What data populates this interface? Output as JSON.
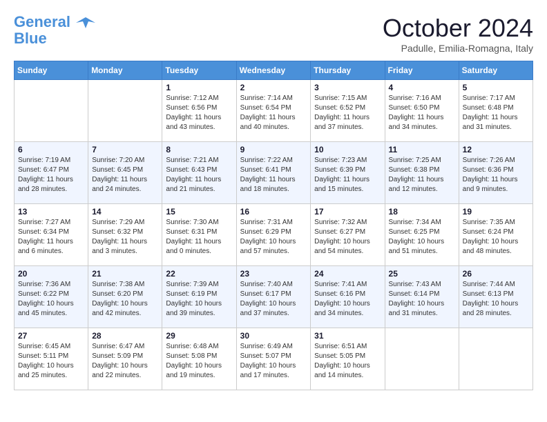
{
  "header": {
    "logo_line1": "General",
    "logo_line2": "Blue",
    "month": "October 2024",
    "location": "Padulle, Emilia-Romagna, Italy"
  },
  "days_of_week": [
    "Sunday",
    "Monday",
    "Tuesday",
    "Wednesday",
    "Thursday",
    "Friday",
    "Saturday"
  ],
  "weeks": [
    [
      {
        "day": "",
        "info": ""
      },
      {
        "day": "",
        "info": ""
      },
      {
        "day": "1",
        "info": "Sunrise: 7:12 AM\nSunset: 6:56 PM\nDaylight: 11 hours and 43 minutes."
      },
      {
        "day": "2",
        "info": "Sunrise: 7:14 AM\nSunset: 6:54 PM\nDaylight: 11 hours and 40 minutes."
      },
      {
        "day": "3",
        "info": "Sunrise: 7:15 AM\nSunset: 6:52 PM\nDaylight: 11 hours and 37 minutes."
      },
      {
        "day": "4",
        "info": "Sunrise: 7:16 AM\nSunset: 6:50 PM\nDaylight: 11 hours and 34 minutes."
      },
      {
        "day": "5",
        "info": "Sunrise: 7:17 AM\nSunset: 6:48 PM\nDaylight: 11 hours and 31 minutes."
      }
    ],
    [
      {
        "day": "6",
        "info": "Sunrise: 7:19 AM\nSunset: 6:47 PM\nDaylight: 11 hours and 28 minutes."
      },
      {
        "day": "7",
        "info": "Sunrise: 7:20 AM\nSunset: 6:45 PM\nDaylight: 11 hours and 24 minutes."
      },
      {
        "day": "8",
        "info": "Sunrise: 7:21 AM\nSunset: 6:43 PM\nDaylight: 11 hours and 21 minutes."
      },
      {
        "day": "9",
        "info": "Sunrise: 7:22 AM\nSunset: 6:41 PM\nDaylight: 11 hours and 18 minutes."
      },
      {
        "day": "10",
        "info": "Sunrise: 7:23 AM\nSunset: 6:39 PM\nDaylight: 11 hours and 15 minutes."
      },
      {
        "day": "11",
        "info": "Sunrise: 7:25 AM\nSunset: 6:38 PM\nDaylight: 11 hours and 12 minutes."
      },
      {
        "day": "12",
        "info": "Sunrise: 7:26 AM\nSunset: 6:36 PM\nDaylight: 11 hours and 9 minutes."
      }
    ],
    [
      {
        "day": "13",
        "info": "Sunrise: 7:27 AM\nSunset: 6:34 PM\nDaylight: 11 hours and 6 minutes."
      },
      {
        "day": "14",
        "info": "Sunrise: 7:29 AM\nSunset: 6:32 PM\nDaylight: 11 hours and 3 minutes."
      },
      {
        "day": "15",
        "info": "Sunrise: 7:30 AM\nSunset: 6:31 PM\nDaylight: 11 hours and 0 minutes."
      },
      {
        "day": "16",
        "info": "Sunrise: 7:31 AM\nSunset: 6:29 PM\nDaylight: 10 hours and 57 minutes."
      },
      {
        "day": "17",
        "info": "Sunrise: 7:32 AM\nSunset: 6:27 PM\nDaylight: 10 hours and 54 minutes."
      },
      {
        "day": "18",
        "info": "Sunrise: 7:34 AM\nSunset: 6:25 PM\nDaylight: 10 hours and 51 minutes."
      },
      {
        "day": "19",
        "info": "Sunrise: 7:35 AM\nSunset: 6:24 PM\nDaylight: 10 hours and 48 minutes."
      }
    ],
    [
      {
        "day": "20",
        "info": "Sunrise: 7:36 AM\nSunset: 6:22 PM\nDaylight: 10 hours and 45 minutes."
      },
      {
        "day": "21",
        "info": "Sunrise: 7:38 AM\nSunset: 6:20 PM\nDaylight: 10 hours and 42 minutes."
      },
      {
        "day": "22",
        "info": "Sunrise: 7:39 AM\nSunset: 6:19 PM\nDaylight: 10 hours and 39 minutes."
      },
      {
        "day": "23",
        "info": "Sunrise: 7:40 AM\nSunset: 6:17 PM\nDaylight: 10 hours and 37 minutes."
      },
      {
        "day": "24",
        "info": "Sunrise: 7:41 AM\nSunset: 6:16 PM\nDaylight: 10 hours and 34 minutes."
      },
      {
        "day": "25",
        "info": "Sunrise: 7:43 AM\nSunset: 6:14 PM\nDaylight: 10 hours and 31 minutes."
      },
      {
        "day": "26",
        "info": "Sunrise: 7:44 AM\nSunset: 6:13 PM\nDaylight: 10 hours and 28 minutes."
      }
    ],
    [
      {
        "day": "27",
        "info": "Sunrise: 6:45 AM\nSunset: 5:11 PM\nDaylight: 10 hours and 25 minutes."
      },
      {
        "day": "28",
        "info": "Sunrise: 6:47 AM\nSunset: 5:09 PM\nDaylight: 10 hours and 22 minutes."
      },
      {
        "day": "29",
        "info": "Sunrise: 6:48 AM\nSunset: 5:08 PM\nDaylight: 10 hours and 19 minutes."
      },
      {
        "day": "30",
        "info": "Sunrise: 6:49 AM\nSunset: 5:07 PM\nDaylight: 10 hours and 17 minutes."
      },
      {
        "day": "31",
        "info": "Sunrise: 6:51 AM\nSunset: 5:05 PM\nDaylight: 10 hours and 14 minutes."
      },
      {
        "day": "",
        "info": ""
      },
      {
        "day": "",
        "info": ""
      }
    ]
  ]
}
